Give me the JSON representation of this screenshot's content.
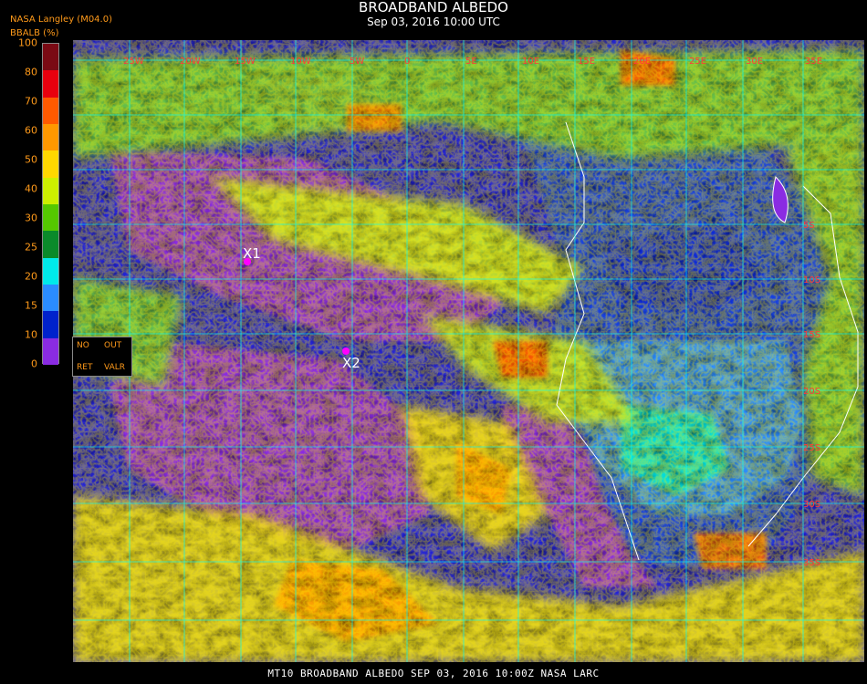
{
  "header": {
    "title": "BROADBAND ALBEDO",
    "subtitle": "Sep 03, 2016 10:00 UTC",
    "source": "NASA Langley (M04.0)"
  },
  "colorbar": {
    "title": "BBALB (%)",
    "labels": [
      "100",
      "80",
      "70",
      "60",
      "50",
      "40",
      "30",
      "25",
      "20",
      "15",
      "10",
      "0"
    ],
    "colors": [
      "#7a0a14",
      "#e8000e",
      "#ff5a00",
      "#ff9800",
      "#ffd800",
      "#cdf000",
      "#55c800",
      "#0a8a2a",
      "#00eaea",
      "#2a8cff",
      "#0022cc",
      "#8a2be2"
    ]
  },
  "legend": {
    "no": "NO",
    "out": "OUT",
    "ret": "RET",
    "valr": "VALR"
  },
  "markers": [
    {
      "label": "X1"
    },
    {
      "label": "X2"
    }
  ],
  "grid_labels": {
    "top": [
      "25W",
      "20W",
      "15W",
      "10W",
      "5W",
      "0",
      "5E",
      "10E",
      "15E",
      "20E",
      "25E",
      "30E",
      "35E"
    ],
    "right": [
      "5S",
      "10S",
      "15S",
      "20S",
      "25S",
      "30S",
      "35S"
    ]
  },
  "footer": "MT10   BROADBAND ALBEDO   SEP 03, 2016 10:00Z   NASA LARC"
}
